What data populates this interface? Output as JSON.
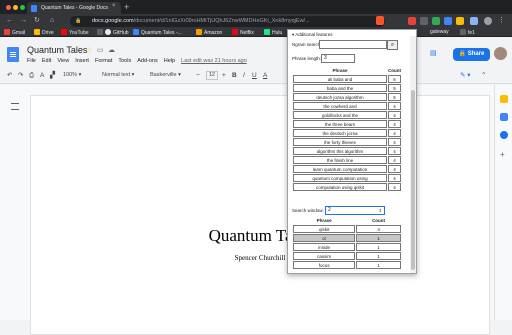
{
  "browser": {
    "tab_title": "Quantum Tales - Google Docs",
    "url_host": "docs.google.com",
    "url_path": "/document/d/1nIGzXr09roHMtTjUQhJ6ZnwWMDHeGKi_Xnk8myqjEw/...",
    "bookmarks": [
      {
        "label": "Gmail",
        "color": "#ea4335"
      },
      {
        "label": "Drive",
        "color": "#fbbc04"
      },
      {
        "label": "YouTube",
        "color": "#ff0000"
      },
      {
        "label": "",
        "color": "#5f6368"
      },
      {
        "label": "GitHub",
        "color": "#e8eaed"
      },
      {
        "label": "Quantum Tales -...",
        "color": "#4285f4"
      },
      {
        "label": "Amazon",
        "color": "#ff9900"
      },
      {
        "label": "Netflix",
        "color": "#e50914"
      },
      {
        "label": "Hulu",
        "color": "#1ce783"
      },
      {
        "label": "gateway",
        "color": "#5f6368"
      },
      {
        "label": "fe1",
        "color": "#5f6368"
      }
    ]
  },
  "docs": {
    "title": "Quantum Tales",
    "menu": [
      "File",
      "Edit",
      "View",
      "Insert",
      "Format",
      "Tools",
      "Add-ons",
      "Help"
    ],
    "last_edit": "Last edit was 21 hours ago",
    "share_label": "Share",
    "zoom": "100%",
    "style": "Normal text",
    "font": "Baskerville",
    "font_size": "12"
  },
  "document": {
    "heading": "Quantum Tales",
    "author": "Spencer Churchill"
  },
  "popup": {
    "section_label": "Additional features",
    "ngram_label": "Ngram search:",
    "ngram_value": "",
    "phrase_length_label": "Phrase length:",
    "phrase_length_value": "3",
    "phrase_header": "Phrase",
    "count_header": "Count",
    "phrases": [
      {
        "phrase": "ali baba and",
        "count": "6"
      },
      {
        "phrase": "baba and the",
        "count": "5"
      },
      {
        "phrase": "deutsch jozsa algorithm",
        "count": "5"
      },
      {
        "phrase": "the cowherd and",
        "count": "4"
      },
      {
        "phrase": "goldilocks and the",
        "count": "4"
      },
      {
        "phrase": "the three bears",
        "count": "4"
      },
      {
        "phrase": "the deutsch jozsa",
        "count": "4"
      },
      {
        "phrase": "the forty thieves",
        "count": "4"
      },
      {
        "phrase": "algorithm this algorithm",
        "count": "4"
      },
      {
        "phrase": "the finish line",
        "count": "4"
      },
      {
        "phrase": "learn quantum computation",
        "count": "4"
      },
      {
        "phrase": "quantum computation using",
        "count": "4"
      },
      {
        "phrase": "computation using qiskit",
        "count": "4"
      }
    ],
    "search_window_label": "Search window:",
    "search_window_value": "2",
    "window_phrase_header": "Phrase",
    "window_count_header": "Count",
    "window_rows": [
      {
        "phrase": "qiskit",
        "count": "4",
        "highlight": false
      },
      {
        "phrase": "or",
        "count": "1",
        "highlight": true
      },
      {
        "phrase": "inside",
        "count": "1",
        "highlight": false
      },
      {
        "phrase": "cassim",
        "count": "1",
        "highlight": false
      },
      {
        "phrase": "focus",
        "count": "1",
        "highlight": false
      }
    ]
  }
}
